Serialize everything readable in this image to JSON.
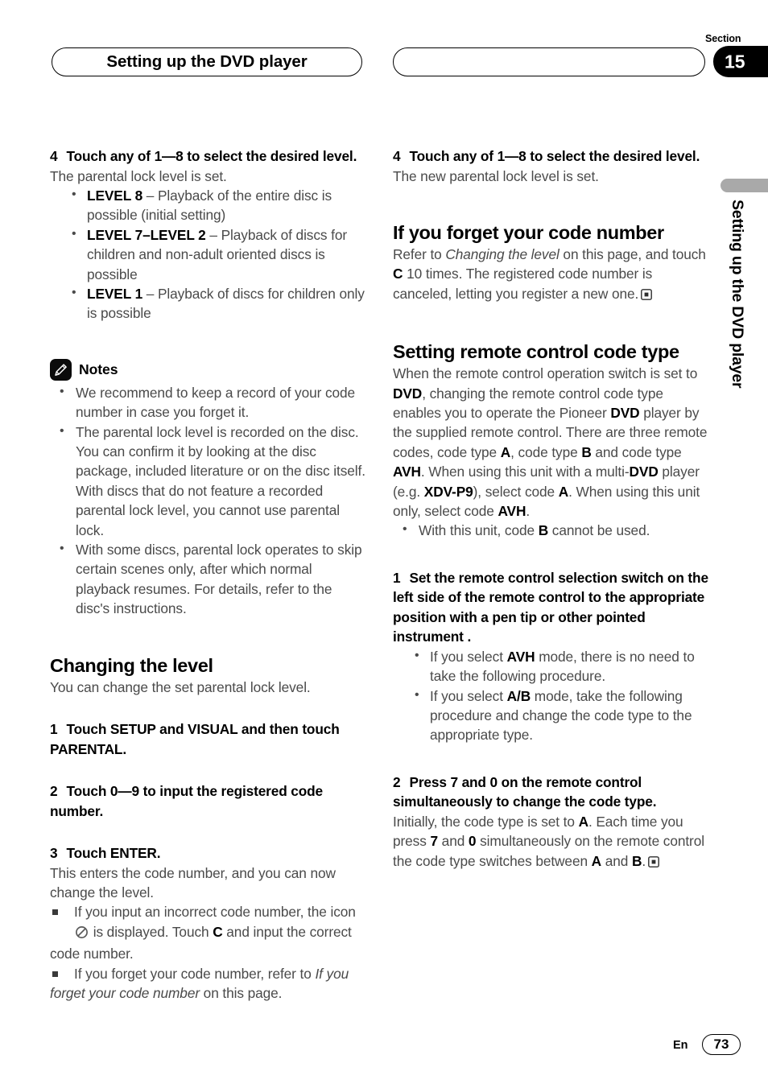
{
  "header": {
    "left_box_title": "Setting up the DVD player",
    "right_box_title": "",
    "section_label": "Section",
    "section_number": "15"
  },
  "side_tab": {
    "vertical_title": "Setting up the DVD player"
  },
  "footer": {
    "language": "En",
    "page_number": "73"
  },
  "left_column": {
    "step4": {
      "number": "4",
      "title": "Touch any of 1—8 to select the desired level.",
      "body": "The parental lock level is set."
    },
    "levels": [
      {
        "term": "LEVEL 8",
        "desc": " – Playback of the entire disc is possible (initial setting)"
      },
      {
        "term": "LEVEL 7–LEVEL 2",
        "desc": " – Playback of discs for children and non-adult oriented discs is possible"
      },
      {
        "term": "LEVEL 1",
        "desc": " – Playback of discs for children only is possible"
      }
    ],
    "notes": {
      "icon": "pencil-icon",
      "title": "Notes",
      "items": [
        "We recommend to keep a record of your code number in case you forget it.",
        "The parental lock level is recorded on the disc. You can confirm it by looking at the disc package, included literature or on the disc itself. With discs that do not feature a recorded parental lock level, you cannot use parental lock.",
        "With some discs, parental lock operates to skip certain scenes only, after which normal playback resumes. For details, refer to the disc's instructions."
      ]
    },
    "changing_the_level": {
      "heading": "Changing the level",
      "intro": "You can change the set parental lock level.",
      "step1": {
        "number": "1",
        "title": "Touch SETUP and VISUAL and then touch PARENTAL."
      },
      "step2": {
        "number": "2",
        "title": "Touch 0—9 to input the registered code number."
      },
      "step3": {
        "number": "3",
        "title": "Touch ENTER.",
        "body": "This enters the code number, and you can now change the level."
      },
      "sub_items": [
        {
          "pre": "If you input an incorrect code number, the icon ",
          "icon": "prohibition-icon",
          "mid": " is displayed. Touch ",
          "bold": "C",
          "post": " and input the correct code number."
        },
        {
          "pre": "If you forget your code number, refer to ",
          "italic": "If you forget your code number",
          "post": " on this page."
        }
      ]
    }
  },
  "right_column": {
    "step4": {
      "number": "4",
      "title": "Touch any of 1—8 to select the desired level.",
      "body": "The new parental lock level is set."
    },
    "forget_code": {
      "heading": "If you forget your code number",
      "body_pre": "Refer to ",
      "body_italic": "Changing the level",
      "body_mid": " on this page, and touch ",
      "body_bold": "C",
      "body_post": " 10 times. The registered code number is canceled, letting you register a new one.",
      "end_marker": "end-of-section-icon"
    },
    "remote_code": {
      "heading": "Setting remote control code type",
      "paragraph": "When the remote control operation switch is set to DVD, changing the remote control code type enables you to operate the Pioneer DVD player by the supplied remote control. There are three remote codes, code type A, code type B and code type AVH. When using this unit with a multi-DVD player (e.g. XDV-P9), select code A. When using this unit only, select code AVH.",
      "note_bullet": "With this unit, code B cannot be used.",
      "step1": {
        "number": "1",
        "title": "Set the remote control selection switch on the left side of the remote control to the appropriate position with a pen tip or other pointed instrument .",
        "bullets": [
          "If you select AVH mode, there is no need to take the following procedure.",
          "If you select A/B mode, take the following procedure and change the code type to the appropriate type."
        ]
      },
      "step2": {
        "number": "2",
        "title": "Press 7 and 0 on the remote control simultaneously to change the code type.",
        "body": "Initially, the code type is set to A. Each time you press 7 and 0 simultaneously on the remote control the code type switches between A and B.",
        "end_marker": "end-of-section-icon"
      }
    }
  }
}
